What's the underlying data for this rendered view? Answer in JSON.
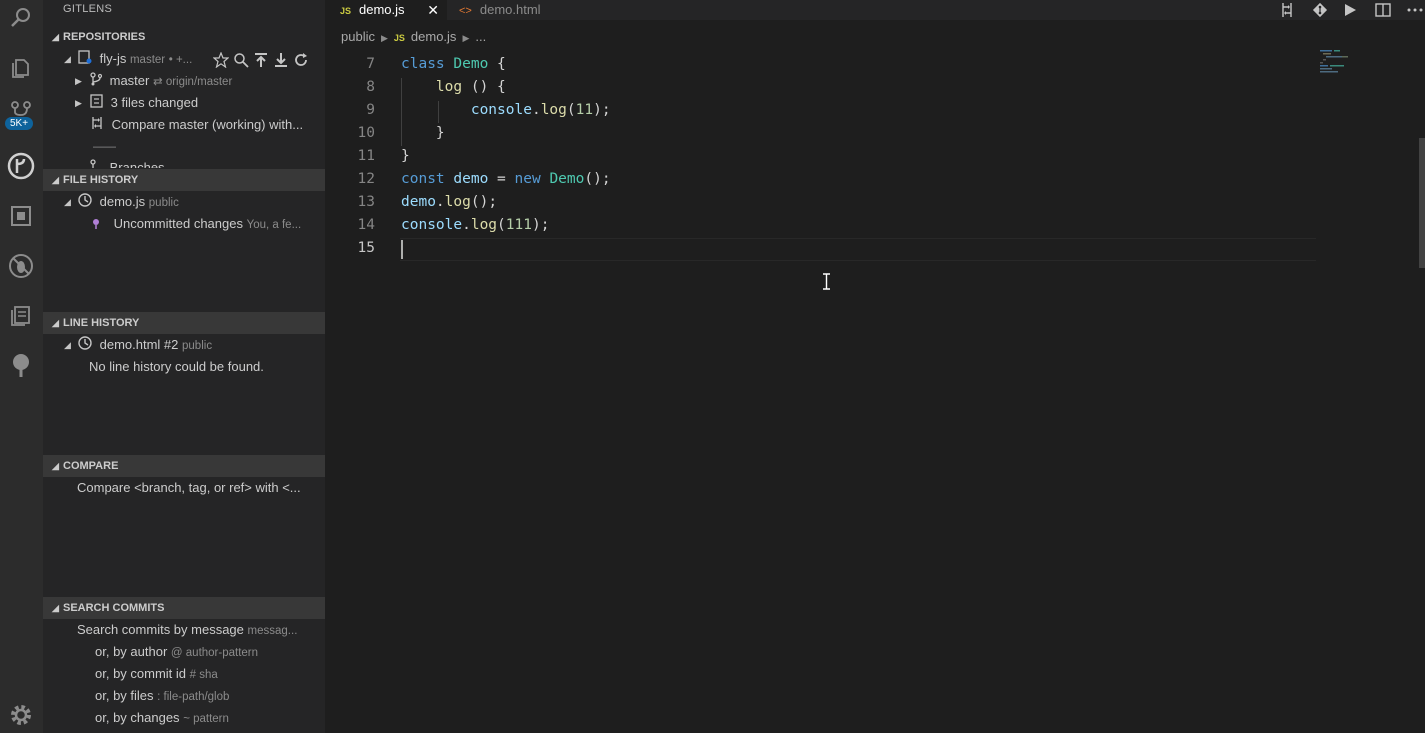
{
  "activity_bar": {
    "badge": "5K+"
  },
  "sidebar": {
    "title": "GITLENS",
    "repositories": {
      "header": "REPOSITORIES",
      "repo_name": "fly-js",
      "repo_branch": "master",
      "repo_status": "• +...",
      "branch": {
        "name": "master",
        "upstream": "⇄  origin/master"
      },
      "files_changed": "3 files changed",
      "compare": "Compare master (working) with...",
      "separator": "——",
      "branches": "Branches"
    },
    "file_history": {
      "header": "FILE HISTORY",
      "file": "demo.js",
      "file_path": "public",
      "uncommitted": "Uncommitted changes",
      "uncommitted_detail": "You, a fe..."
    },
    "line_history": {
      "header": "LINE HISTORY",
      "file": "demo.html #2",
      "file_path": "public",
      "empty": "No line history could be found."
    },
    "compare": {
      "header": "COMPARE",
      "item": "Compare <branch, tag, or ref> with <..."
    },
    "search_commits": {
      "header": "SEARCH COMMITS",
      "by_message": "Search commits by message",
      "by_message_hint": "messag...",
      "by_author": "or, by author",
      "by_author_hint": "@ author-pattern",
      "by_commit": "or, by commit id",
      "by_commit_hint": "# sha",
      "by_files": "or, by files",
      "by_files_hint": ": file-path/glob",
      "by_changes": "or, by changes",
      "by_changes_hint": "~ pattern"
    }
  },
  "tabs": [
    {
      "badge": "JS",
      "label": "demo.js"
    },
    {
      "badge": "<>",
      "label": "demo.html"
    }
  ],
  "breadcrumb": {
    "folder": "public",
    "badge": "JS",
    "file": "demo.js",
    "more": "..."
  },
  "editor": {
    "line_numbers": [
      "7",
      "8",
      "9",
      "10",
      "11",
      "12",
      "13",
      "14",
      "15"
    ]
  },
  "colors": {
    "accent": "#0e639c",
    "keyword": "#569cd6",
    "type": "#4ec9b0",
    "function": "#dcdcaa",
    "number": "#b5cea8"
  }
}
